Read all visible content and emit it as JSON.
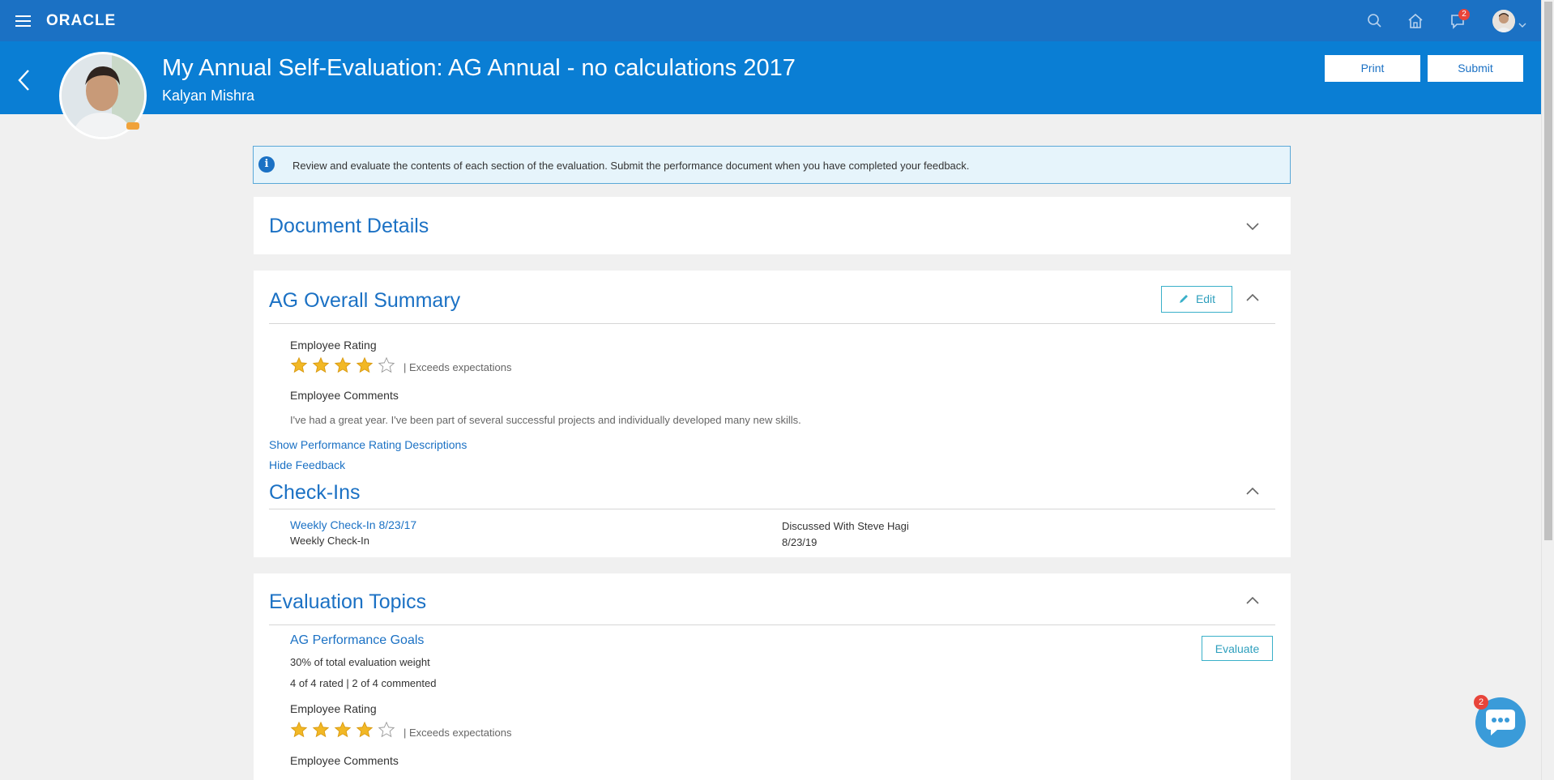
{
  "nav": {
    "logo": "ORACLE",
    "notifications_count": "2"
  },
  "header": {
    "title": "My Annual Self-Evaluation: AG Annual - no calculations 2017",
    "employee_name": "Kalyan Mishra",
    "print_label": "Print",
    "submit_label": "Submit"
  },
  "info_message": "Review and evaluate the contents of each section of the evaluation. Submit the performance document when you have completed your feedback.",
  "document_details": {
    "title": "Document Details"
  },
  "overall_summary": {
    "title": "AG Overall Summary",
    "edit_label": "Edit",
    "rating_label": "Employee Rating",
    "rating_value": 4,
    "rating_max": 5,
    "rating_text": "| Exceeds expectations",
    "comments_label": "Employee Comments",
    "comments_text": "I've had a great year. I've been part of several successful projects and individually developed many new skills.",
    "show_descriptions_link": "Show Performance Rating Descriptions",
    "hide_feedback_link": "Hide Feedback"
  },
  "checkins": {
    "title": "Check-Ins",
    "items": [
      {
        "link": "Weekly Check-In 8/23/17",
        "type": "Weekly Check-In",
        "discussed": "Discussed With Steve Hagi",
        "date": "8/23/19"
      }
    ]
  },
  "evaluation_topics": {
    "title": "Evaluation Topics",
    "goal_title": "AG Performance Goals",
    "weight_text": "30% of total evaluation weight",
    "progress_text": "4 of 4 rated | 2 of 4 commented",
    "evaluate_label": "Evaluate",
    "rating_label": "Employee Rating",
    "rating_value": 4,
    "rating_max": 5,
    "rating_text": "| Exceeds expectations",
    "comments_label": "Employee Comments"
  },
  "chat": {
    "badge": "2"
  },
  "colors": {
    "nav_bg": "#1b71c4",
    "header_bg": "#0a7ed4",
    "accent": "#1b71c4",
    "star_fill": "#f2b825"
  }
}
